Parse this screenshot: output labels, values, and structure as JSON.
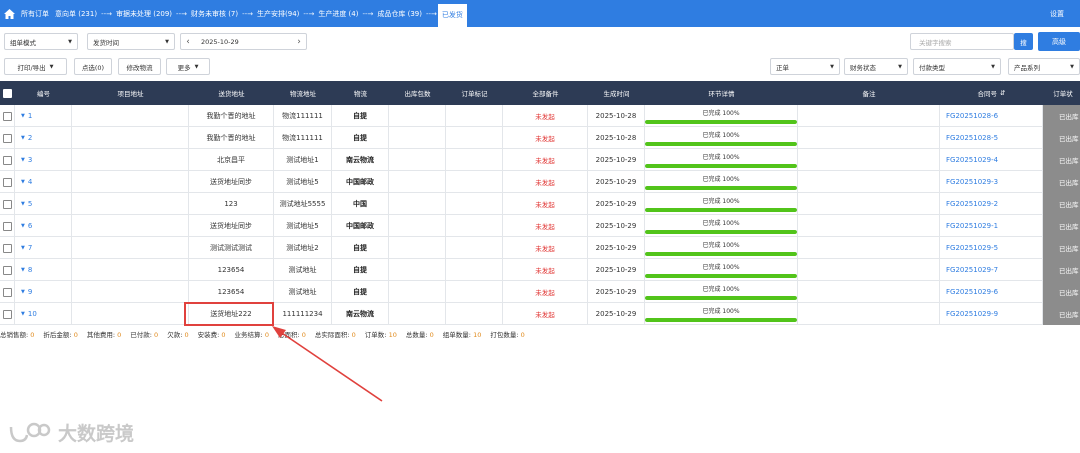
{
  "nav": {
    "tabs": [
      {
        "label": "所有订单",
        "sep": ""
      },
      {
        "label": "意向单 (231)",
        "sep": ""
      },
      {
        "label": "审据未处理 (209)",
        "sep": "--→"
      },
      {
        "label": "财务未审核 (7)",
        "sep": "--→"
      },
      {
        "label": "生产安排(94)",
        "sep": "--→"
      },
      {
        "label": "生产进度 (4)",
        "sep": "--→"
      },
      {
        "label": "成品仓库 (39)",
        "sep": "--→"
      },
      {
        "label": "已发货",
        "sep": "--→"
      }
    ],
    "settings_label": "设置"
  },
  "filters": {
    "mode_select": "组单模式",
    "time_select": "发货时间",
    "date_value": "2025-10-29",
    "keyword_placeholder": "关键字搜索",
    "search_button": "搜",
    "advanced_button": "高级"
  },
  "actions": {
    "print_export": "打印/导出",
    "select_count": "点选(0)",
    "edit_logistics": "修改物流",
    "more": "更多",
    "normal_select": "正单",
    "finance_status": "财务状态",
    "payment_type": "付款类型",
    "product_series": "产品系列"
  },
  "table": {
    "columns": [
      "编号",
      "项目地址",
      "送货地址",
      "物流地址",
      "物流",
      "出库包数",
      "订单标记",
      "全部备件",
      "生成时间",
      "环节详情",
      "备注",
      "合同号",
      "订单状"
    ],
    "progress_label": "已完成 100%",
    "progress_fraction": 1.0,
    "status_label": "已出库",
    "rows": [
      {
        "no": "1",
        "delivery": "我勤个晋的地址",
        "logistics_addr": "物流111111",
        "logistics": "自提",
        "spare": "未发起",
        "date": "2025-10-28",
        "contract": "FG20251028-6"
      },
      {
        "no": "2",
        "delivery": "我勤个晋的地址",
        "logistics_addr": "物流111111",
        "logistics": "自提",
        "spare": "未发起",
        "date": "2025-10-28",
        "contract": "FG20251028-5"
      },
      {
        "no": "3",
        "delivery": "北京昌平",
        "logistics_addr": "测试地址1",
        "logistics": "南云物流",
        "spare": "未发起",
        "date": "2025-10-29",
        "contract": "FG20251029-4"
      },
      {
        "no": "4",
        "delivery": "送货地址同步",
        "logistics_addr": "测试地址5",
        "logistics": "中国邮政",
        "spare": "未发起",
        "date": "2025-10-29",
        "contract": "FG20251029-3"
      },
      {
        "no": "5",
        "delivery": "123",
        "logistics_addr": "测试地址5555",
        "logistics": "中国",
        "spare": "未发起",
        "date": "2025-10-29",
        "contract": "FG20251029-2"
      },
      {
        "no": "6",
        "delivery": "送货地址同步",
        "logistics_addr": "测试地址5",
        "logistics": "中国邮政",
        "spare": "未发起",
        "date": "2025-10-29",
        "contract": "FG20251029-1"
      },
      {
        "no": "7",
        "delivery": "测试测试测试",
        "logistics_addr": "测试地址2",
        "logistics": "自提",
        "spare": "未发起",
        "date": "2025-10-29",
        "contract": "FG20251029-5"
      },
      {
        "no": "8",
        "delivery": "123654",
        "logistics_addr": "测试地址",
        "logistics": "自提",
        "spare": "未发起",
        "date": "2025-10-29",
        "contract": "FG20251029-7"
      },
      {
        "no": "9",
        "delivery": "123654",
        "logistics_addr": "测试地址",
        "logistics": "自提",
        "spare": "未发起",
        "date": "2025-10-29",
        "contract": "FG20251029-6"
      },
      {
        "no": "10",
        "delivery": "送货地址222",
        "logistics_addr": "111111234",
        "logistics": "南云物流",
        "spare": "未发起",
        "date": "2025-10-29",
        "contract": "FG20251029-9"
      }
    ]
  },
  "footer": [
    {
      "label": "总销售额:",
      "value": "0"
    },
    {
      "label": "折后金额:",
      "value": "0"
    },
    {
      "label": "其他费用:",
      "value": "0"
    },
    {
      "label": "已付款:",
      "value": "0"
    },
    {
      "label": "欠款:",
      "value": "0"
    },
    {
      "label": "安装费:",
      "value": "0"
    },
    {
      "label": "业务结算:",
      "value": "0"
    },
    {
      "label": "总面积:",
      "value": "0"
    },
    {
      "label": "总实际面积:",
      "value": "0"
    },
    {
      "label": "订单数:",
      "value": "10"
    },
    {
      "label": "总数量:",
      "value": "0"
    },
    {
      "label": "组单数量:",
      "value": "10"
    },
    {
      "label": "打包数量:",
      "value": "0"
    }
  ],
  "watermark": "大数跨境",
  "colors": {
    "brand": "#2f7de1",
    "header_bg": "#2d3b55",
    "progress": "#52c41a",
    "annotation": "#e0413d"
  }
}
